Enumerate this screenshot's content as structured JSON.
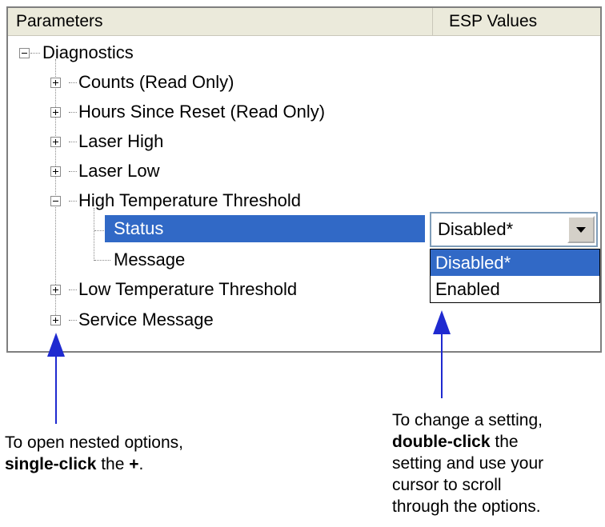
{
  "columns": {
    "parameters": "Parameters",
    "esp_values": "ESP Values"
  },
  "tree": {
    "root": "Diagnostics",
    "items": [
      {
        "label": "Counts (Read Only)",
        "expander": "plus"
      },
      {
        "label": "Hours Since Reset (Read Only)",
        "expander": "plus"
      },
      {
        "label": "Laser High",
        "expander": "plus"
      },
      {
        "label": "Laser Low",
        "expander": "plus"
      },
      {
        "label": "High Temperature Threshold",
        "expander": "minus",
        "children": [
          {
            "label": "Status",
            "selected": true
          },
          {
            "label": "Message",
            "selected": false
          }
        ]
      },
      {
        "label": "Low Temperature Threshold",
        "expander": "plus"
      },
      {
        "label": "Service Message",
        "expander": "plus"
      }
    ]
  },
  "combo": {
    "value": "Disabled*",
    "options": [
      "Disabled*",
      "Enabled"
    ],
    "highlighted": "Disabled*"
  },
  "callouts": {
    "left": {
      "line1": "To open nested options,",
      "bold": "single-click",
      "mid": " the ",
      "plus": "+",
      "end": "."
    },
    "right": {
      "line1": "To change a setting,",
      "bold": "double-click",
      "after_bold": " the",
      "line3": "setting and use your",
      "line4": "cursor to scroll",
      "line5": "through the options."
    }
  },
  "colors": {
    "selection": "#3169c6",
    "arrow": "#1f2ad0",
    "header": "#ebeadb"
  },
  "icons": {
    "expand": "plus-box-icon",
    "collapse": "minus-box-icon",
    "dropdown": "chevron-down-icon"
  }
}
